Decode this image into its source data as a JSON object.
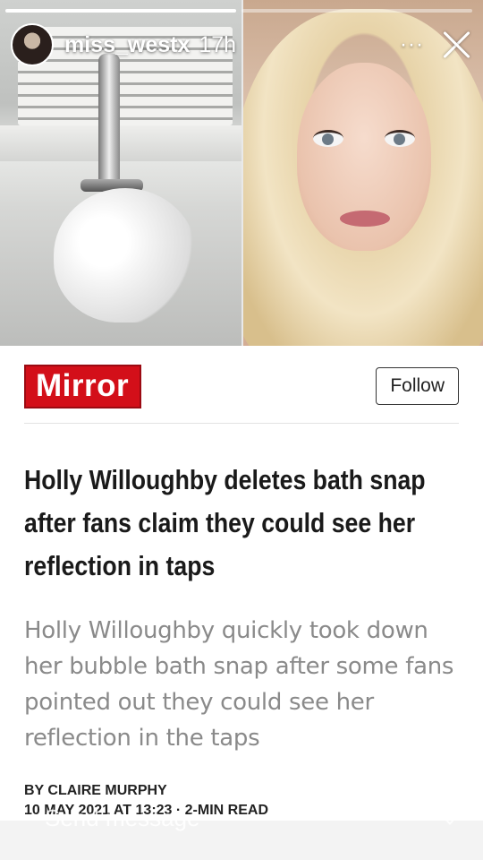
{
  "story": {
    "username": "miss_westx",
    "time": "17h",
    "more_label": "···",
    "progress": [
      1.0,
      0.0
    ],
    "icons": {
      "close": "close-icon",
      "more": "more-icon",
      "avatar": "avatar"
    }
  },
  "article": {
    "publisher": "Mirror",
    "follow_label": "Follow",
    "headline": "Holly Willoughby deletes bath snap after fans claim they could see her reflection in taps",
    "summary": "Holly Willoughby quickly took down her bubble bath snap after some fans pointed out they could see her reflection in the taps",
    "byline": "BY CLAIRE MURPHY",
    "date": "10 MAY 2021 AT 13:23 · 2-MIN READ",
    "brand_color": "#d30f19"
  },
  "reply": {
    "placeholder": "Send message"
  }
}
